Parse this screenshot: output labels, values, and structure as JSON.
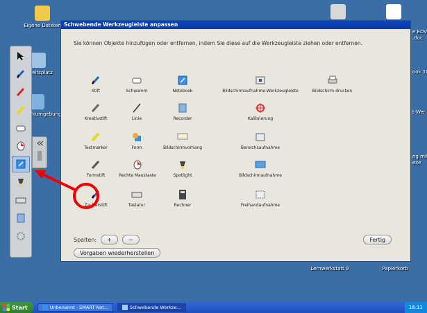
{
  "desktop": {
    "icons": [
      {
        "label": "Eigene Dateien",
        "icon": "folder-icon"
      },
      {
        "label": "Arbeitsplatz",
        "icon": "computer-icon"
      },
      {
        "label": "Netzwerkumgebung",
        "icon": "network-icon"
      },
      {
        "label": "Lernwerkstatt 9",
        "icon": "folder-icon"
      },
      {
        "label": "Papierkorb",
        "icon": "trash-icon"
      }
    ],
    "right_clipped": [
      "e EDV 25",
      ".doc",
      "ook 10",
      "t-Wer...",
      "ng mit",
      "exe"
    ]
  },
  "dialog": {
    "title": "Schwebende Werkzeugleiste anpassen",
    "intro": "Sie können Objekte hinzufügen oder entfernen, indem Sie diese auf die Werkzeugleiste ziehen oder entfernen.",
    "items": [
      {
        "label": "Stift",
        "icon": "pen-icon"
      },
      {
        "label": "Schwamm",
        "icon": "eraser-icon"
      },
      {
        "label": "Notebook",
        "icon": "notebook-icon"
      },
      {
        "label": "Bildschirmaufnahme-Werkzeugleiste",
        "icon": "capture-toolbar-icon"
      },
      {
        "label": "Bildschirm drucken",
        "icon": "printer-icon"
      },
      {
        "label": "Kreativstift",
        "icon": "creative-pen-icon"
      },
      {
        "label": "Linie",
        "icon": "line-icon"
      },
      {
        "label": "Recorder",
        "icon": "recorder-icon"
      },
      {
        "label": "Kalibrierung",
        "icon": "calibration-icon"
      },
      {
        "label": "Textmarker",
        "icon": "highlighter-icon"
      },
      {
        "label": "Form",
        "icon": "shape-icon"
      },
      {
        "label": "Bildschirmvorhang",
        "icon": "screen-shade-icon"
      },
      {
        "label": "Bereichsaufnahme",
        "icon": "area-capture-icon"
      },
      {
        "label": "Formstift",
        "icon": "shape-pen-icon"
      },
      {
        "label": "Rechte Maustaste",
        "icon": "right-click-icon"
      },
      {
        "label": "Spotlight",
        "icon": "spotlight-icon"
      },
      {
        "label": "Bildschirmaufnahme",
        "icon": "screen-capture-icon"
      },
      {
        "label": "Zauberstift",
        "icon": "magic-pen-icon"
      },
      {
        "label": "Tastatur",
        "icon": "keyboard-icon"
      },
      {
        "label": "Rechner",
        "icon": "calculator-icon"
      },
      {
        "label": "Freihandaufnahme",
        "icon": "freehand-capture-icon"
      }
    ],
    "columns_label": "Spalten:",
    "plus_label": "+",
    "minus_label": "−",
    "done_label": "Fertig",
    "reset_label": "Vorgaben wiederherstellen"
  },
  "taskbar": {
    "start_label": "Start",
    "tasks": [
      {
        "label": "Unbenannt - SMART Not..."
      },
      {
        "label": "Schwebende Werkze..."
      }
    ],
    "clock": "16:11"
  },
  "colors": {
    "accent": "#e00000",
    "title_blue": "#0a46c4"
  }
}
